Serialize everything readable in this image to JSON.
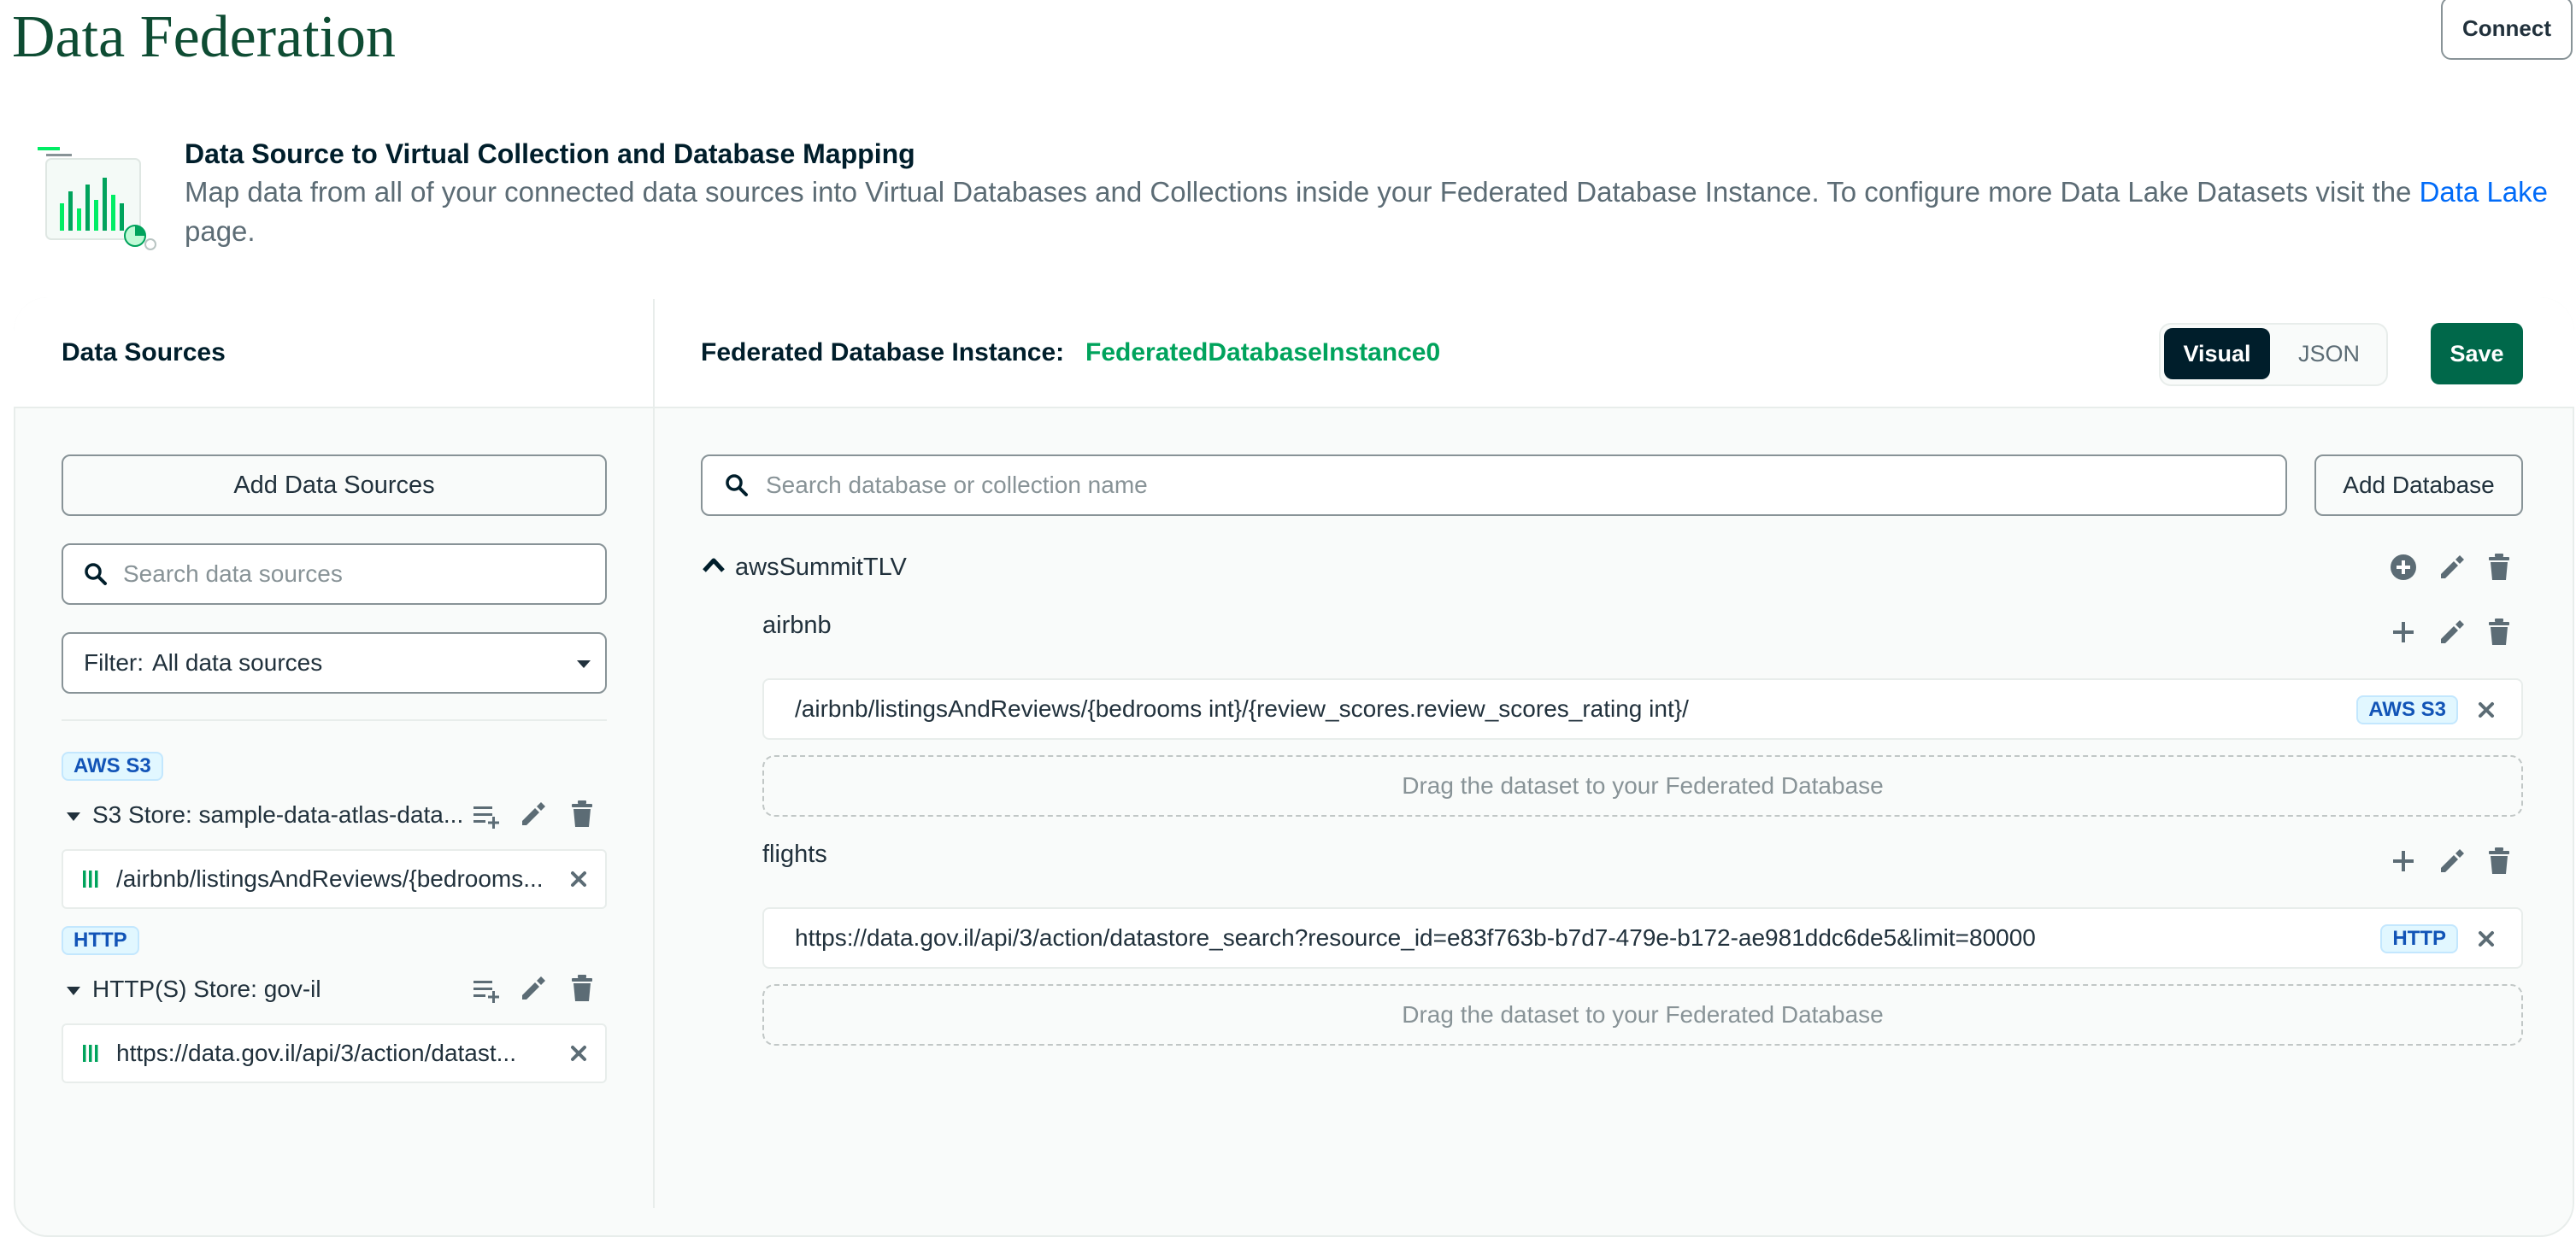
{
  "page": {
    "title": "Data Federation",
    "connect_label": "Connect"
  },
  "banner": {
    "title": "Data Source to Virtual Collection and Database Mapping",
    "description": "Map data from all of your connected data sources into Virtual Databases and Collections inside your Federated Database Instance. To configure more Data Lake Datasets visit the ",
    "link_text": "Data Lake",
    "description_end": " page."
  },
  "left_panel": {
    "title": "Data Sources",
    "add_button": "Add Data Sources",
    "search_placeholder": "Search data sources",
    "filter_label": "Filter:",
    "filter_value": "All data sources",
    "groups": [
      {
        "tag": "AWS S3",
        "store": "S3 Store: sample-data-atlas-data...",
        "dataset": "/airbnb/listingsAndReviews/{bedrooms..."
      },
      {
        "tag": "HTTP",
        "store": "HTTP(S) Store: gov-il",
        "dataset": "https://data.gov.il/api/3/action/datast..."
      }
    ]
  },
  "right_panel": {
    "instance_label": "Federated Database Instance:",
    "instance_name": "FederatedDatabaseInstance0",
    "view_tabs": {
      "visual": "Visual",
      "json": "JSON",
      "active": "Visual"
    },
    "save_label": "Save",
    "search_placeholder": "Search database or collection name",
    "add_database_label": "Add Database",
    "database": {
      "name": "awsSummitTLV",
      "collections": [
        {
          "name": "airbnb",
          "mapping_path": "/airbnb/listingsAndReviews/{bedrooms int}/{review_scores.review_scores_rating int}/",
          "mapping_tag": "AWS S3",
          "drop_text": "Drag the dataset to your Federated Database"
        },
        {
          "name": "flights",
          "mapping_path": "https://data.gov.il/api/3/action/datastore_search?resource_id=e83f763b-b7d7-479e-b172-ae981ddc6de5&limit=80000",
          "mapping_tag": "HTTP",
          "drop_text": "Drag the dataset to your Federated Database"
        }
      ]
    }
  },
  "colors": {
    "brand_dark_green": "#0e4c33",
    "instance_green": "#00a35c",
    "save_green": "#00684a",
    "link_blue": "#016bf8",
    "tag_blue": "#1254b7"
  },
  "icons": [
    "search-icon",
    "filter-caret-icon",
    "chevron-up-icon",
    "add-circle-icon",
    "plus-icon",
    "pencil-icon",
    "trash-icon",
    "add-to-list-icon",
    "dataset-bars-icon",
    "close-icon",
    "chart-illustration"
  ]
}
